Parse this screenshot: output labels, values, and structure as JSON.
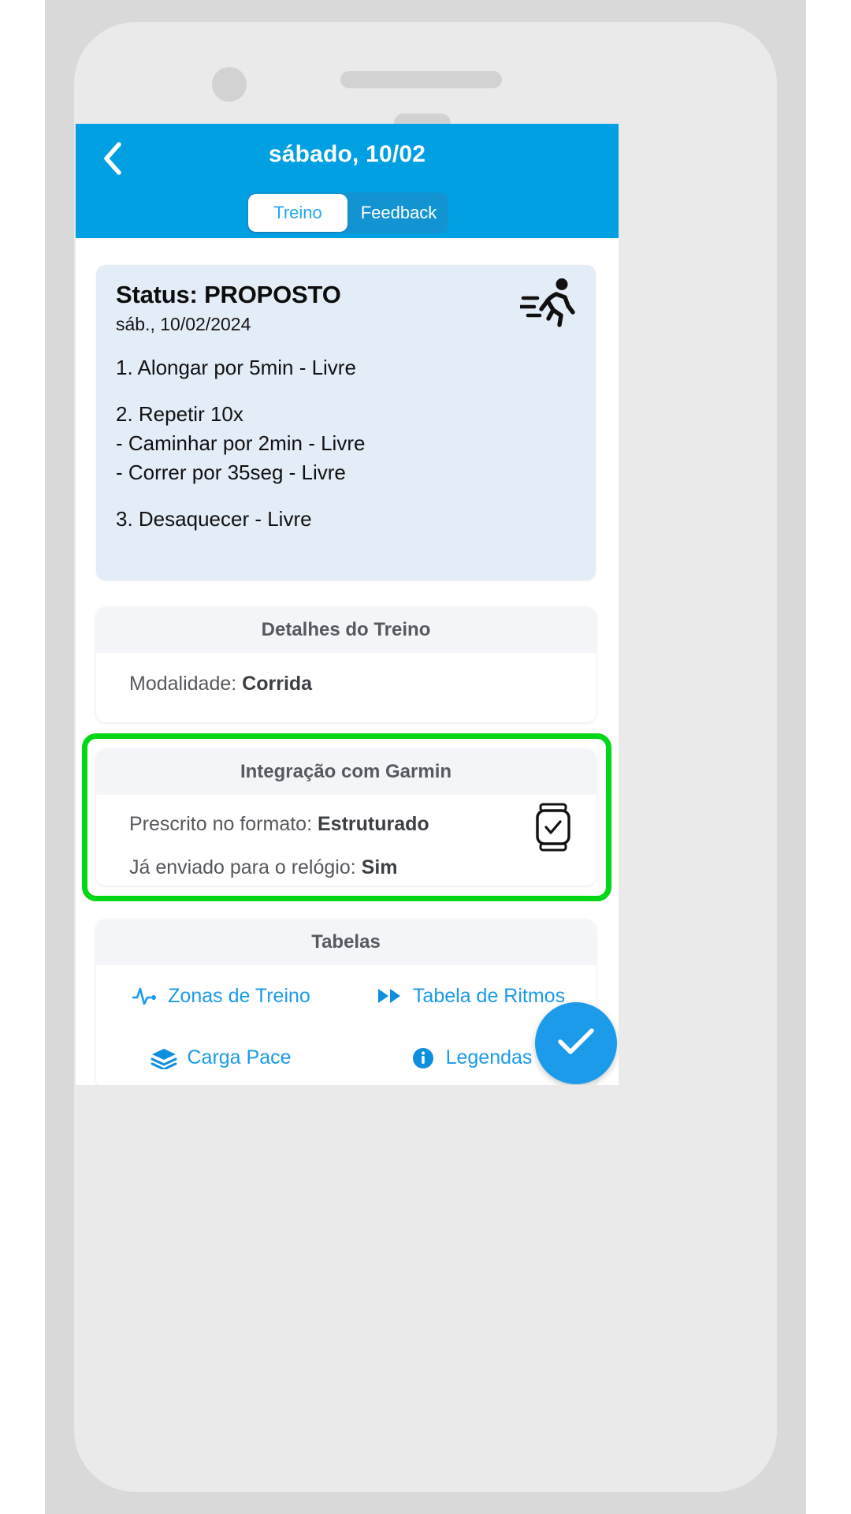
{
  "appbar": {
    "title": "sábado, 10/02",
    "back_icon": "chevron-left-icon",
    "brand_color": "#00a0e3"
  },
  "tabs": [
    {
      "label": "Treino",
      "active": true
    },
    {
      "label": "Feedback",
      "active": false
    }
  ],
  "status_card": {
    "title": "Status: PROPOSTO",
    "date": "sáb., 10/02/2024",
    "icon": "running-person-icon",
    "background_color": "#e3edf7",
    "steps": [
      "1. Alongar por 5min - Livre",
      "",
      "2. Repetir 10x",
      "- Caminhar por 2min - Livre",
      "- Correr por 35seg - Livre",
      "",
      "3. Desaquecer - Livre"
    ]
  },
  "details_card": {
    "header": "Detalhes do Treino",
    "rows": [
      {
        "label": "Modalidade: ",
        "value": "Corrida"
      }
    ]
  },
  "garmin_card": {
    "header": "Integração com Garmin",
    "highlight_color": "#00d717",
    "icon": "smartwatch-icon",
    "rows": [
      {
        "label": "Prescrito no formato: ",
        "value": "Estruturado"
      },
      {
        "label": "Já enviado para o relógio: ",
        "value": "Sim"
      }
    ]
  },
  "tabelas_card": {
    "header": "Tabelas",
    "link_color": "#1b9bea",
    "links": [
      {
        "label": "Zonas de Treino",
        "icon": "pulse-wave-icon"
      },
      {
        "label": "Tabela de Ritmos",
        "icon": "fast-forward-icon"
      },
      {
        "label": "Carga Pace",
        "icon": "layers-icon"
      },
      {
        "label": "Legendas",
        "icon": "info-circle-icon"
      }
    ]
  },
  "fab": {
    "icon": "check-icon",
    "color": "#1b9bea"
  }
}
